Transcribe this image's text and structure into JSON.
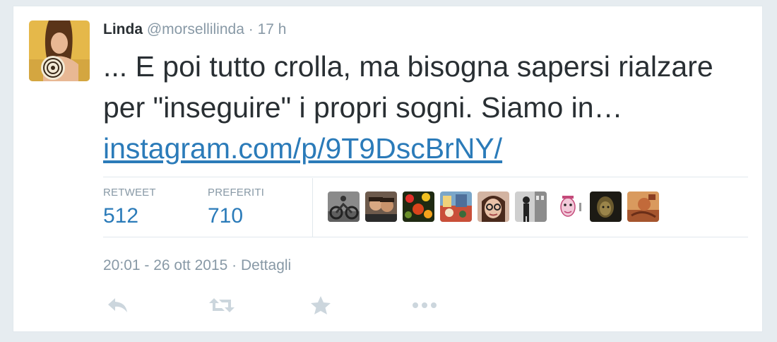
{
  "tweet": {
    "author_name": "Linda",
    "author_handle": "@morsellilinda",
    "separator": "·",
    "time_ago": "17 h",
    "text": "... E poi tutto crolla, ma bisogna sapersi rialzare per \"inseguire\" i propri sogni. Siamo in…",
    "link_text": "instagram.com/p/9T9DscBrNY/"
  },
  "stats": {
    "retweet_label": "RETWEET",
    "retweet_count": "512",
    "favorites_label": "PREFERITI",
    "favorites_count": "710"
  },
  "favorited_by": [
    {
      "icon": "avatar-motorbike"
    },
    {
      "icon": "avatar-couple"
    },
    {
      "icon": "avatar-flowers"
    },
    {
      "icon": "avatar-colorful"
    },
    {
      "icon": "avatar-glasses"
    },
    {
      "icon": "avatar-bw-street"
    },
    {
      "icon": "avatar-cartoon"
    },
    {
      "icon": "avatar-dark-portrait"
    },
    {
      "icon": "avatar-painting"
    }
  ],
  "meta": {
    "timestamp": "20:01 - 26 ott 2015",
    "separator": "·",
    "details_label": "Dettagli"
  },
  "actions": [
    {
      "icon": "reply-icon"
    },
    {
      "icon": "retweet-icon"
    },
    {
      "icon": "favorite-star-icon"
    },
    {
      "icon": "more-icon"
    }
  ],
  "colors": {
    "link": "#2b7bb9",
    "muted": "#8899a6",
    "text": "#292f33",
    "action_icon": "#ccd6dd",
    "border": "#e1e8ed",
    "page_bg": "#e6ecf0"
  }
}
